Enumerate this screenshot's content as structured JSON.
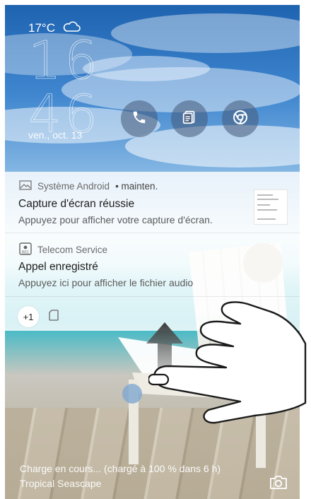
{
  "status": {
    "temperature": "17°C",
    "weather_icon": "cloud-icon"
  },
  "clock": {
    "hours": "16",
    "minutes": "46",
    "date": "ven., oct. 13"
  },
  "shortcuts": [
    {
      "name": "phone-icon"
    },
    {
      "name": "memo-icon"
    },
    {
      "name": "chrome-icon"
    }
  ],
  "notifications": [
    {
      "app": "Système Android",
      "time": "• mainten.",
      "title": "Capture d'écran réussie",
      "body": "Appuyez pour afficher votre capture d'écran.",
      "icon": "image-icon"
    },
    {
      "app": "Telecom Service",
      "title": "Appel enregistré",
      "body": "Appuyez ici pour afficher le fichier audio",
      "icon": "rec-icon"
    }
  ],
  "overflow": {
    "count": "+1"
  },
  "footer": {
    "charging": "Charge en cours... (chargé à 100 % dans 6 h)",
    "wallpaper": "Tropical Seascape"
  }
}
